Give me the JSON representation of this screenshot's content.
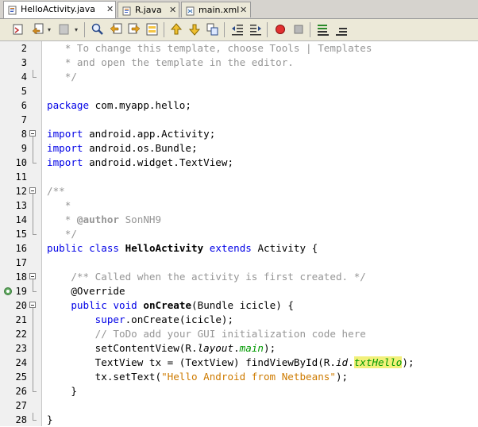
{
  "tabs": [
    {
      "label": "HelloActivity.java",
      "active": true
    },
    {
      "label": "R.java",
      "active": false
    },
    {
      "label": "main.xml",
      "active": false
    }
  ],
  "toolbar": {
    "icons": [
      "source-history-icon",
      "back-icon",
      "dropdown-arrow-icon",
      "forward-icon",
      "dropdown-arrow-icon",
      "find-icon",
      "find-previous-icon",
      "find-next-icon",
      "toggle-highlight-icon",
      "previous-bookmark-icon",
      "next-bookmark-icon",
      "toggle-bookmark-icon",
      "shift-left-icon",
      "shift-right-icon",
      "start-macro-icon",
      "stop-macro-icon",
      "comment-icon",
      "uncomment-icon"
    ]
  },
  "colors": {
    "keyword": "#0000e6",
    "comment": "#969696",
    "string": "#ce7b00",
    "field": "#009900",
    "highlight": "#f2f07a"
  },
  "editor": {
    "lines": [
      {
        "num": "2",
        "fold": "",
        "tokens": [
          {
            "t": "   * To change this template, choose Tools | Templates",
            "c": "cm"
          }
        ]
      },
      {
        "num": "3",
        "fold": "",
        "tokens": [
          {
            "t": "   * and open the template in the editor.",
            "c": "cm"
          }
        ]
      },
      {
        "num": "4",
        "fold": "end",
        "tokens": [
          {
            "t": "   */",
            "c": "cm"
          }
        ]
      },
      {
        "num": "5",
        "fold": "",
        "tokens": []
      },
      {
        "num": "6",
        "fold": "",
        "tokens": [
          {
            "t": "package",
            "c": "kw"
          },
          {
            "t": " com.myapp.hello;",
            "c": ""
          }
        ]
      },
      {
        "num": "7",
        "fold": "",
        "tokens": []
      },
      {
        "num": "8",
        "fold": "start",
        "tokens": [
          {
            "t": "import",
            "c": "kw"
          },
          {
            "t": " android.app.Activity;",
            "c": ""
          }
        ]
      },
      {
        "num": "9",
        "fold": "mid",
        "tokens": [
          {
            "t": "import",
            "c": "kw"
          },
          {
            "t": " android.os.Bundle;",
            "c": ""
          }
        ]
      },
      {
        "num": "10",
        "fold": "end",
        "tokens": [
          {
            "t": "import",
            "c": "kw"
          },
          {
            "t": " android.widget.TextView;",
            "c": ""
          }
        ]
      },
      {
        "num": "11",
        "fold": "",
        "tokens": []
      },
      {
        "num": "12",
        "fold": "start",
        "tokens": [
          {
            "t": "/**",
            "c": "cm"
          }
        ]
      },
      {
        "num": "13",
        "fold": "mid",
        "tokens": [
          {
            "t": "   *",
            "c": "cm"
          }
        ]
      },
      {
        "num": "14",
        "fold": "mid",
        "tokens": [
          {
            "t": "   * ",
            "c": "cm"
          },
          {
            "t": "@author",
            "c": "cm b"
          },
          {
            "t": " SonNH9",
            "c": "cm"
          }
        ]
      },
      {
        "num": "15",
        "fold": "end",
        "tokens": [
          {
            "t": "   */",
            "c": "cm"
          }
        ]
      },
      {
        "num": "16",
        "fold": "",
        "tokens": [
          {
            "t": "public",
            "c": "kw"
          },
          {
            "t": " ",
            "c": ""
          },
          {
            "t": "class",
            "c": "kw"
          },
          {
            "t": " ",
            "c": ""
          },
          {
            "t": "HelloActivity",
            "c": "b"
          },
          {
            "t": " ",
            "c": ""
          },
          {
            "t": "extends",
            "c": "kw"
          },
          {
            "t": " Activity {",
            "c": ""
          }
        ]
      },
      {
        "num": "17",
        "fold": "",
        "tokens": []
      },
      {
        "num": "18",
        "fold": "start",
        "tokens": [
          {
            "t": "    ",
            "c": ""
          },
          {
            "t": "/** Called when the activity is first created. */",
            "c": "cm"
          }
        ]
      },
      {
        "num": "19",
        "fold": "end",
        "marker": "override",
        "tokens": [
          {
            "t": "    @Override",
            "c": ""
          }
        ]
      },
      {
        "num": "20",
        "fold": "start",
        "tokens": [
          {
            "t": "    ",
            "c": ""
          },
          {
            "t": "public",
            "c": "kw"
          },
          {
            "t": " ",
            "c": ""
          },
          {
            "t": "void",
            "c": "kw"
          },
          {
            "t": " ",
            "c": ""
          },
          {
            "t": "onCreate",
            "c": "b"
          },
          {
            "t": "(Bundle icicle) {",
            "c": ""
          }
        ]
      },
      {
        "num": "21",
        "fold": "mid",
        "tokens": [
          {
            "t": "        ",
            "c": ""
          },
          {
            "t": "super",
            "c": "kw"
          },
          {
            "t": ".onCreate(icicle);",
            "c": ""
          }
        ]
      },
      {
        "num": "22",
        "fold": "mid",
        "tokens": [
          {
            "t": "        ",
            "c": ""
          },
          {
            "t": "// ToDo add your GUI initialization code here",
            "c": "cm"
          }
        ]
      },
      {
        "num": "23",
        "fold": "mid",
        "tokens": [
          {
            "t": "        setContentView(R.",
            "c": ""
          },
          {
            "t": "layout",
            "c": "it"
          },
          {
            "t": ".",
            "c": ""
          },
          {
            "t": "main",
            "c": "fld"
          },
          {
            "t": ");",
            "c": ""
          }
        ]
      },
      {
        "num": "24",
        "fold": "mid",
        "tokens": [
          {
            "t": "        TextView tx = (TextView) findViewById(R.",
            "c": ""
          },
          {
            "t": "id",
            "c": "it"
          },
          {
            "t": ".",
            "c": ""
          },
          {
            "t": "txtHello",
            "c": "fld hl"
          },
          {
            "t": ");",
            "c": ""
          }
        ]
      },
      {
        "num": "25",
        "fold": "mid",
        "tokens": [
          {
            "t": "        tx.setText(",
            "c": ""
          },
          {
            "t": "\"Hello Android from Netbeans\"",
            "c": "str"
          },
          {
            "t": ");",
            "c": ""
          }
        ]
      },
      {
        "num": "26",
        "fold": "end",
        "tokens": [
          {
            "t": "    }",
            "c": ""
          }
        ]
      },
      {
        "num": "27",
        "fold": "",
        "tokens": []
      },
      {
        "num": "28",
        "fold": "end",
        "tokens": [
          {
            "t": "}",
            "c": ""
          }
        ]
      }
    ]
  }
}
